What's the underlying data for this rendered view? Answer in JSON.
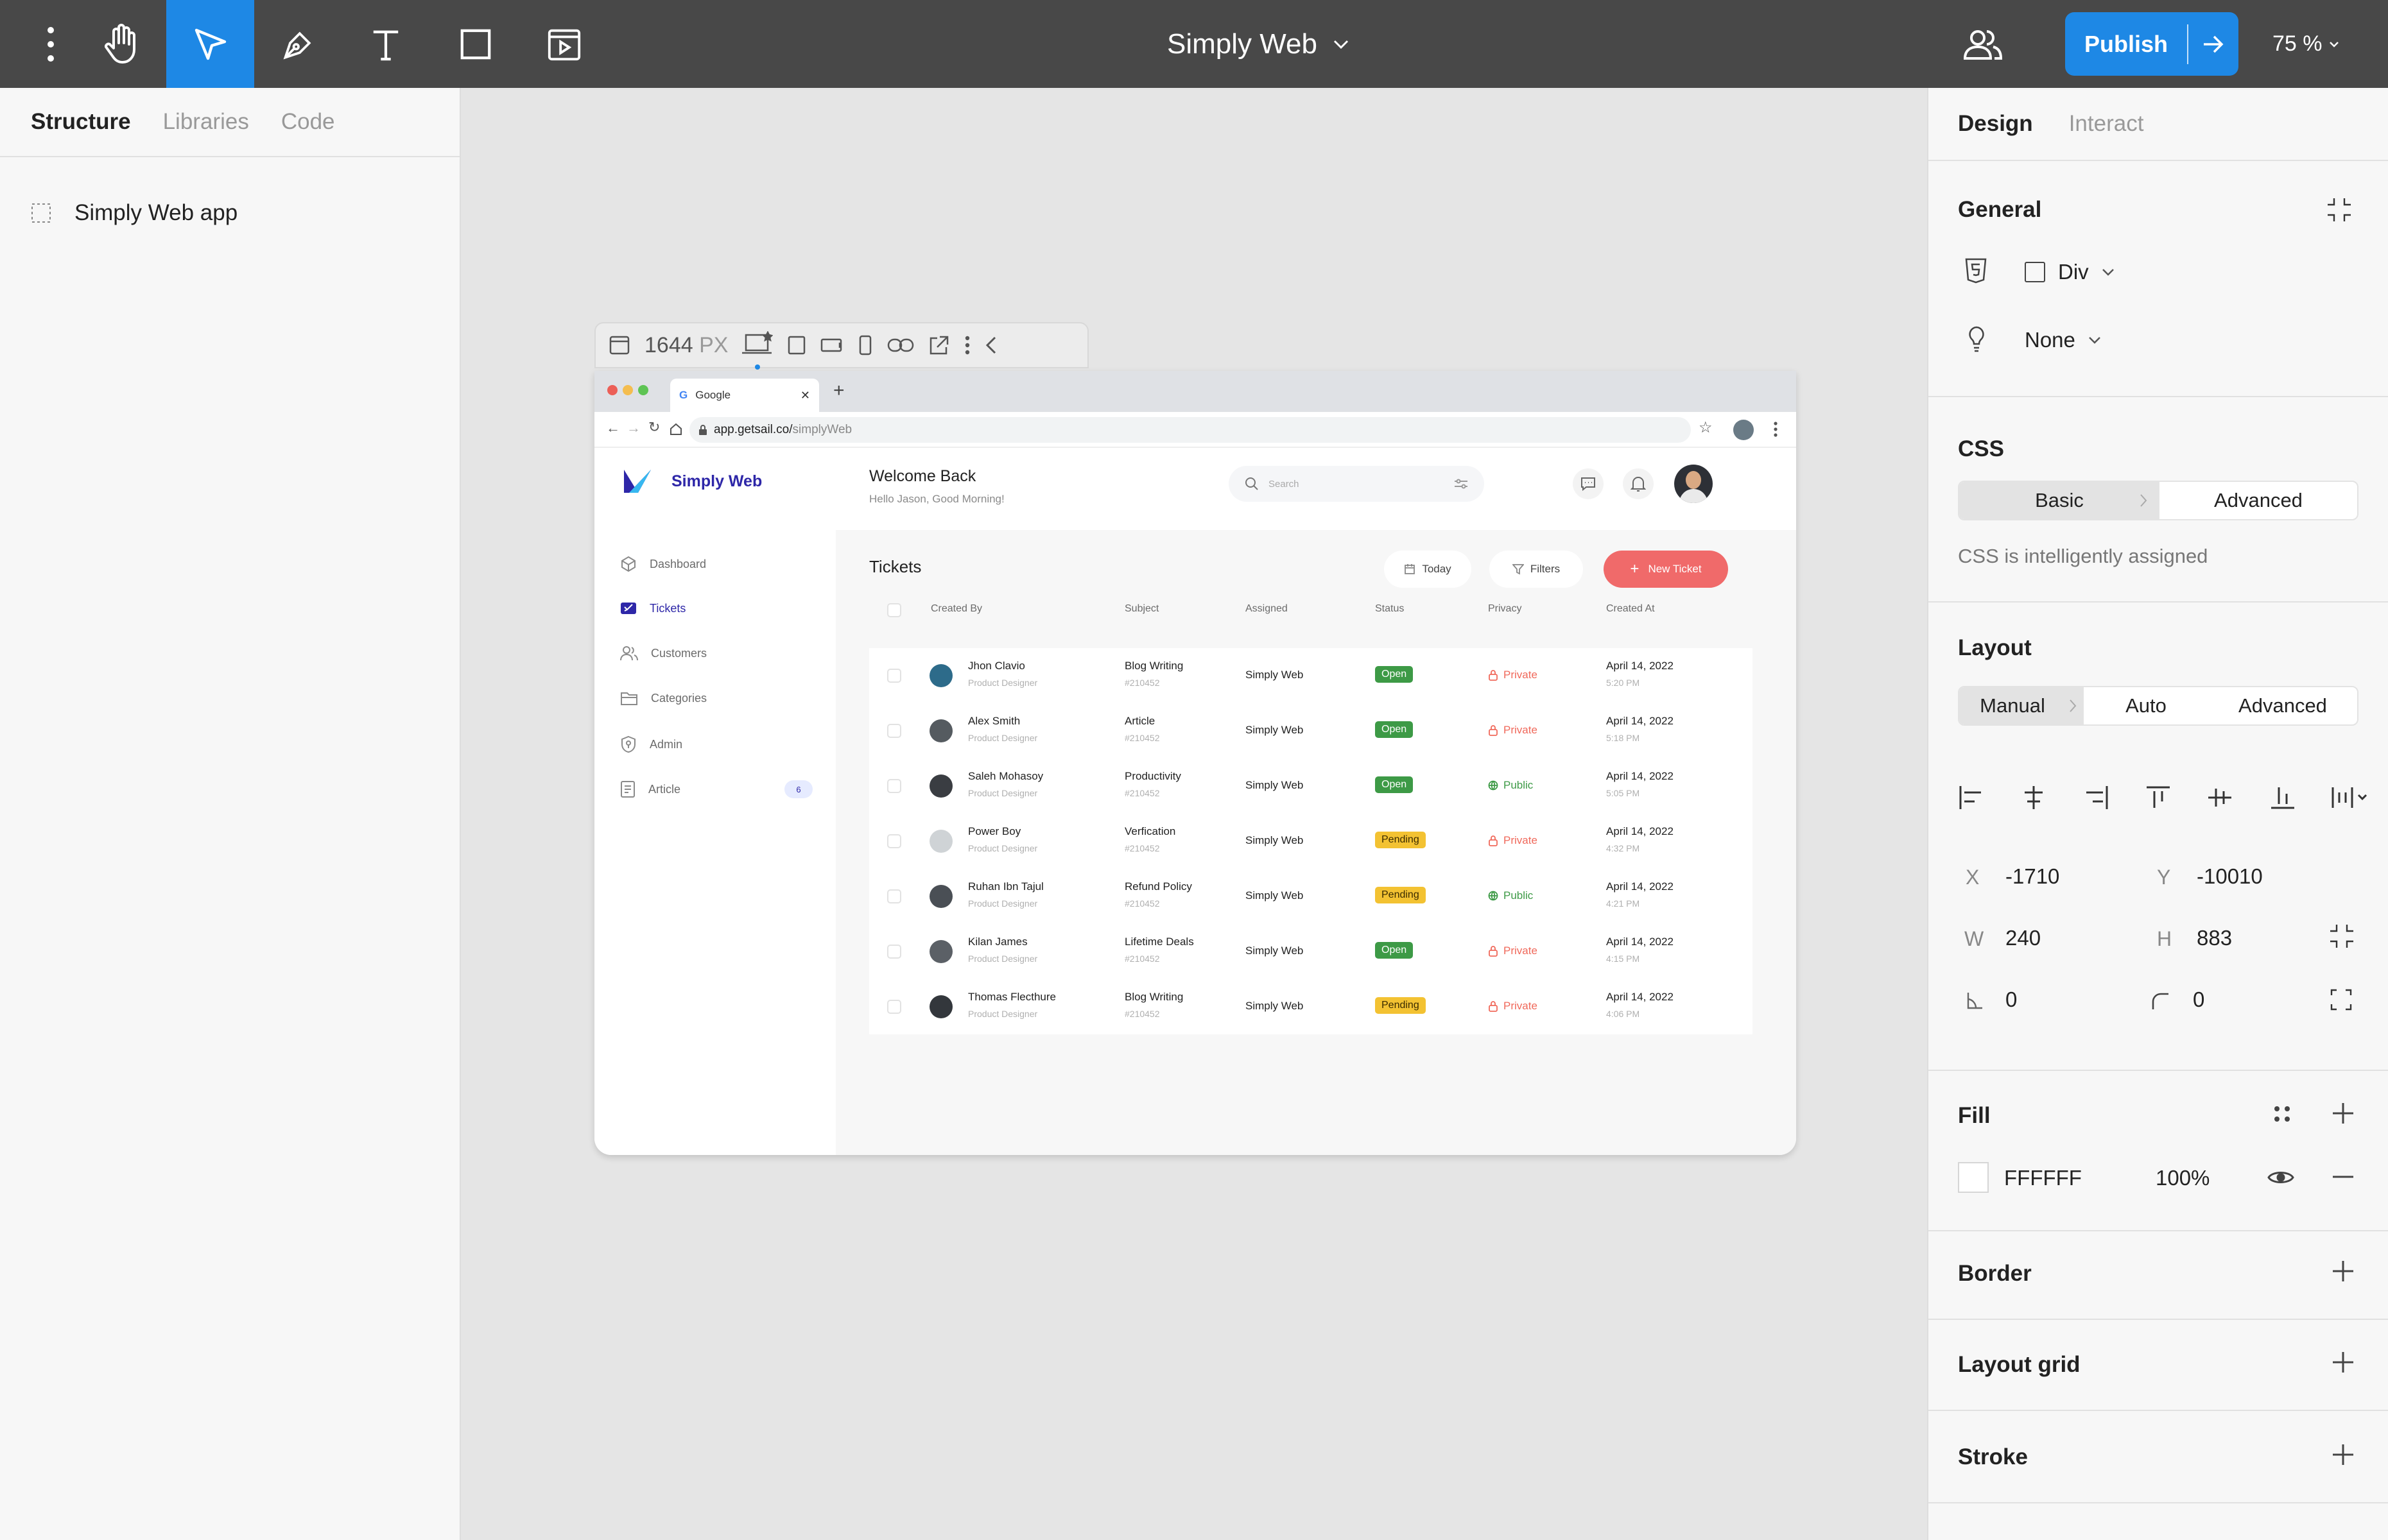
{
  "topbar": {
    "title": "Simply Web",
    "publish_label": "Publish",
    "zoom": "75 %"
  },
  "left_panel": {
    "tabs": [
      "Structure",
      "Libraries",
      "Code"
    ],
    "tree_item": "Simply Web app"
  },
  "frame_toolbar": {
    "width_value": "1644",
    "width_unit": "PX"
  },
  "browser": {
    "tab_title": "Google",
    "url_host": "app.getsail.co/",
    "url_path": "simplyWeb"
  },
  "app": {
    "brand": "Simply Web",
    "welcome_title": "Welcome Back",
    "welcome_sub": "Hello Jason, Good Morning!",
    "search_placeholder": "Search",
    "nav": [
      {
        "label": "Dashboard"
      },
      {
        "label": "Tickets"
      },
      {
        "label": "Customers"
      },
      {
        "label": "Categories"
      },
      {
        "label": "Admin"
      },
      {
        "label": "Article",
        "badge": "6"
      }
    ],
    "section_title": "Tickets",
    "btn_today": "Today",
    "btn_filters": "Filters",
    "btn_new": "New Ticket",
    "columns": [
      "Created By",
      "Subject",
      "Assigned",
      "Status",
      "Privacy",
      "Created At"
    ],
    "rows": [
      {
        "name": "Jhon Clavio",
        "role": "Product Designer",
        "subject": "Blog Writing",
        "id": "#210452",
        "assigned": "Simply Web",
        "status": "Open",
        "privacy": "Private",
        "date": "April 14, 2022",
        "time": "5:20 PM"
      },
      {
        "name": "Alex Smith",
        "role": "Product Designer",
        "subject": "Article",
        "id": "#210452",
        "assigned": "Simply Web",
        "status": "Open",
        "privacy": "Private",
        "date": "April 14, 2022",
        "time": "5:18 PM"
      },
      {
        "name": "Saleh Mohasoy",
        "role": "Product Designer",
        "subject": "Productivity",
        "id": "#210452",
        "assigned": "Simply Web",
        "status": "Open",
        "privacy": "Public",
        "date": "April 14, 2022",
        "time": "5:05 PM"
      },
      {
        "name": "Power Boy",
        "role": "Product Designer",
        "subject": "Verfication",
        "id": "#210452",
        "assigned": "Simply Web",
        "status": "Pending",
        "privacy": "Private",
        "date": "April 14, 2022",
        "time": "4:32 PM"
      },
      {
        "name": "Ruhan Ibn Tajul",
        "role": "Product Designer",
        "subject": "Refund Policy",
        "id": "#210452",
        "assigned": "Simply Web",
        "status": "Pending",
        "privacy": "Public",
        "date": "April 14, 2022",
        "time": "4:21 PM"
      },
      {
        "name": "Kilan James",
        "role": "Product Designer",
        "subject": "Lifetime Deals",
        "id": "#210452",
        "assigned": "Simply Web",
        "status": "Open",
        "privacy": "Private",
        "date": "April 14, 2022",
        "time": "4:15 PM"
      },
      {
        "name": "Thomas Flecthure",
        "role": "Product Designer",
        "subject": "Blog Writing",
        "id": "#210452",
        "assigned": "Simply Web",
        "status": "Pending",
        "privacy": "Private",
        "date": "April 14, 2022",
        "time": "4:06 PM"
      }
    ]
  },
  "right_panel": {
    "tabs": [
      "Design",
      "Interact"
    ],
    "general": {
      "title": "General",
      "tag": "Div",
      "action": "None"
    },
    "css": {
      "title": "CSS",
      "modes": [
        "Basic",
        "Advanced"
      ],
      "note": "CSS is intelligently assigned"
    },
    "layout": {
      "title": "Layout",
      "modes": [
        "Manual",
        "Auto",
        "Advanced"
      ],
      "x_label": "X",
      "x": "-1710",
      "y_label": "Y",
      "y": "-10010",
      "w_label": "W",
      "w": "240",
      "h_label": "H",
      "h": "883",
      "rotation": "0",
      "radius": "0"
    },
    "fill": {
      "title": "Fill",
      "hex": "FFFFFF",
      "opacity": "100%"
    },
    "border": {
      "title": "Border"
    },
    "layout_grid": {
      "title": "Layout grid"
    },
    "stroke": {
      "title": "Stroke"
    }
  },
  "colors": {
    "accent": "#1e88e5",
    "toolbar": "#484848",
    "brand": "#2e27a8",
    "new_ticket": "#f06a6a",
    "open": "#3d9a46",
    "pending": "#f3c232",
    "private": "#f0695b",
    "public": "#3d9a46"
  }
}
